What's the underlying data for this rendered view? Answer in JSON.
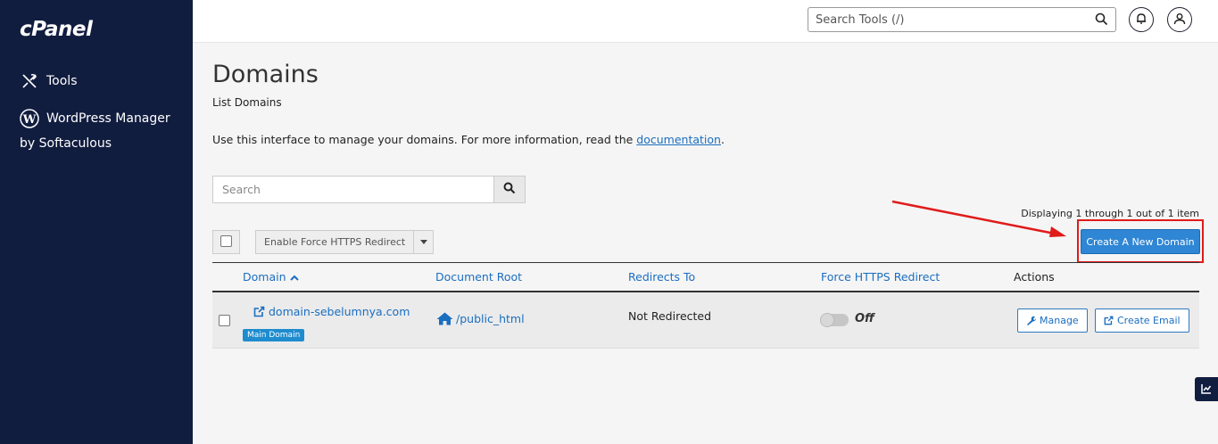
{
  "app": {
    "logo": "cPanel"
  },
  "sidebar": {
    "items": [
      {
        "label": "Tools",
        "icon": "tools-icon"
      },
      {
        "label_line1": "WordPress Manager",
        "label_line2": "by Softaculous",
        "icon": "wordpress-icon"
      }
    ]
  },
  "header": {
    "search_placeholder": "Search Tools (/)",
    "notifications_icon": "bell-icon",
    "user_icon": "user-icon"
  },
  "page": {
    "title": "Domains",
    "subtitle": "List Domains",
    "description_prefix": "Use this interface to manage your domains. For more information, read the ",
    "description_link": "documentation",
    "description_suffix": "."
  },
  "search": {
    "placeholder": "Search"
  },
  "toolbar": {
    "force_https_label": "Enable Force HTTPS Redirect",
    "display_count": "Displaying 1 through 1 out of 1 item",
    "create_domain_label": "Create A New Domain"
  },
  "table": {
    "columns": [
      "Domain",
      "Document Root",
      "Redirects To",
      "Force HTTPS Redirect",
      "Actions"
    ],
    "rows": [
      {
        "domain": "domain-sebelumnya.com",
        "badge": "Main Domain",
        "document_root": "/public_html",
        "redirects_to": "Not Redirected",
        "force_https": "Off",
        "actions": [
          "Manage",
          "Create Email"
        ]
      }
    ]
  },
  "colors": {
    "sidebar_bg": "#111d3f",
    "link": "#1a6ec0",
    "primary_button": "#2e86d4",
    "annotation_red": "#e01b1b"
  }
}
